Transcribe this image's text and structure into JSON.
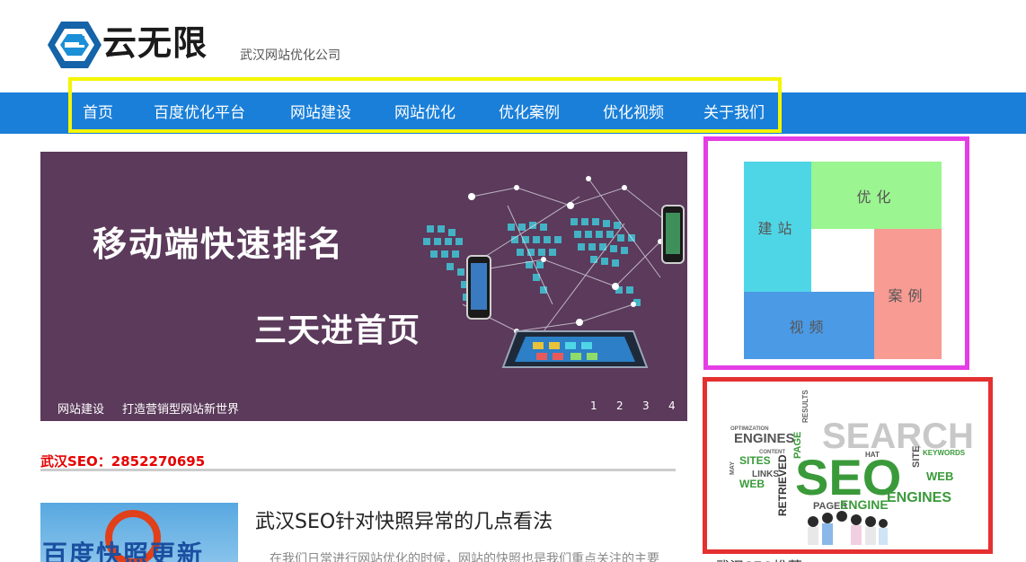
{
  "header": {
    "logo_text": "云无限",
    "tagline": "武汉网站优化公司"
  },
  "nav": {
    "items": [
      "首页",
      "百度优化平台",
      "网站建设",
      "网站优化",
      "优化案例",
      "优化视频",
      "关于我们"
    ]
  },
  "banner": {
    "title": "移动端快速排名",
    "subtitle": "三天进首页",
    "caption_1": "网站建设",
    "caption_2": "打造营销型网站新世界",
    "dots": [
      "1",
      "2",
      "3",
      "4"
    ]
  },
  "contact": {
    "text": "武汉SEO：2852270695"
  },
  "article": {
    "thumb_text": "百度快照更新",
    "title": "武汉SEO针对快照异常的几点看法",
    "excerpt": "在我们日常进行网站优化的时候，网站的快照也是我们重点关注的主要"
  },
  "tiles": {
    "build": "建站",
    "optimize": "优化",
    "case": "案例",
    "video": "视频"
  },
  "seo_image": {
    "words": [
      "SEARCH",
      "SEO",
      "ENGINES",
      "SITES",
      "LINKS",
      "WEB",
      "RETRIEVED",
      "PAGES",
      "ENGINE",
      "ENGINES",
      "OPTIMIZATION",
      "RESULTS",
      "PAGE",
      "SITE",
      "CONTENT",
      "HAT",
      "KEYWORDS",
      "MAY",
      "WEB"
    ]
  },
  "sidebar": {
    "heading": "武汉SEO推荐"
  },
  "colors": {
    "nav_bg": "#1a7fd8",
    "nav_highlight": "#f5f500",
    "tiles_border": "#e53de5",
    "seo_border": "#e53030",
    "contact": "#e60000",
    "tile_build": "#4fd6e6",
    "tile_optimize": "#9bf590",
    "tile_case": "#f79b93",
    "tile_video": "#4b9ae6",
    "banner_bg": "#5b3a5b"
  }
}
